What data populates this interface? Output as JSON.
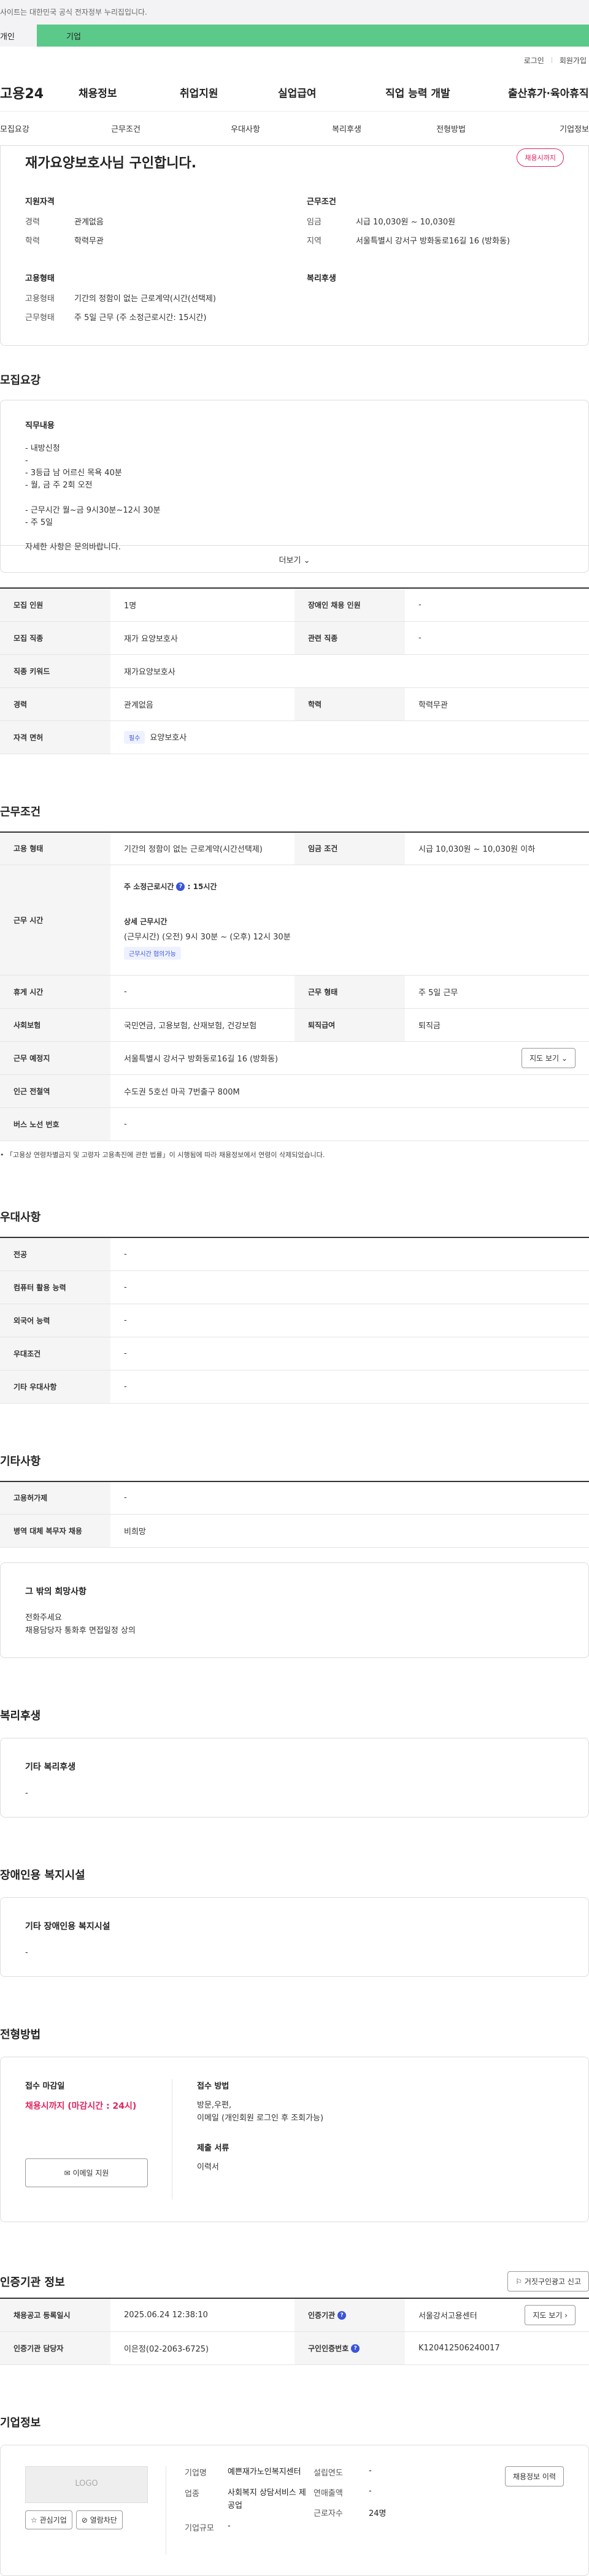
{
  "top_notice": "사이트는 대한민국 공식 전자정부 누리집입니다.",
  "tabs": {
    "person": "개인",
    "corp": "기업"
  },
  "util": {
    "login": "로그인",
    "join": "회원가입"
  },
  "logo": "고용24",
  "gnb": [
    "채용정보",
    "취업지원",
    "실업급여",
    "직업 능력 개발",
    "출산휴가·육아휴직"
  ],
  "subnav": [
    "모집요강",
    "근무조건",
    "우대사항",
    "복리후생",
    "전형방법",
    "기업정보"
  ],
  "summary": {
    "title": "재가요양보호사님 구인합니다.",
    "status": "채용시까지",
    "qual_title": "지원자격",
    "qual": [
      {
        "k": "경력",
        "v": "관계없음"
      },
      {
        "k": "학력",
        "v": "학력무관"
      }
    ],
    "cond_title": "근무조건",
    "cond": [
      {
        "k": "임금",
        "v": "시급 10,030원 ~ 10,030원"
      },
      {
        "k": "지역",
        "v": "서울특별시 강서구 방화동로16길 16 (방화동)"
      }
    ],
    "type_title": "고용형태",
    "type": [
      {
        "k": "고용형태",
        "v": "기간의 정함이 없는 근로계약(시간(선택제)"
      },
      {
        "k": "근무형태",
        "v": "주 5일 근무 (주 소정근로시간: 15시간)"
      }
    ],
    "welfare_title": "복리후생"
  },
  "recruit": {
    "title": "모집요강",
    "job_label": "직무내용",
    "lines": [
      "- 내방신청",
      "-",
      "- 3등급 남 어르신 목욕 40분",
      "- 월, 금 주 2회 오전",
      "",
      "- 근무시간 월~금 9시30분~12시 30분",
      "- 주 5일",
      "",
      "자세한 사항은 문의바랍니다."
    ],
    "more": "더보기",
    "rows": {
      "r1": [
        "모집 인원",
        "1명",
        "장애인 채용 인원",
        "-"
      ],
      "r2": [
        "모집 직종",
        "재가 요양보호사",
        "관련 직종",
        "-"
      ],
      "r3": [
        "직종 키워드",
        "재가요양보호사"
      ],
      "r4": [
        "경력",
        "관계없음",
        "학력",
        "학력무관"
      ],
      "r5": [
        "자격 면허",
        "필수",
        "요양보호사"
      ]
    }
  },
  "work": {
    "title": "근무조건",
    "r1": [
      "고용 형태",
      "기간의 정함이 없는 근로계약(시간선택제)",
      "임금 조건",
      "시급 10,030원 ~ 10,030원 이하"
    ],
    "hours_label": "근무 시간",
    "weekly": "주 소정근로시간",
    "weekly_val": ": 15시간",
    "detail_title": "상세 근무시간",
    "detail": "(근무시간) (오전) 9시 30분 ~ (오후) 12시 30분",
    "detail_chip": "근무시간 협의가능",
    "r3": [
      "휴게 시간",
      "-",
      "근무 형태",
      "주 5일 근무"
    ],
    "r4": [
      "사회보험",
      "국민연금, 고용보험, 산재보험, 건강보험",
      "퇴직급여",
      "퇴직금"
    ],
    "r5": [
      "근무 예정지",
      "서울특별시 강서구 방화동로16길 16 (방화동)"
    ],
    "map_btn": "지도 보기",
    "r6": [
      "인근 전철역",
      "수도권 5호선 마곡 7번출구 800M"
    ],
    "r7": [
      "버스 노선 번호",
      "-"
    ],
    "note": "「고용상 연령차별금지 및 고령자 고용촉진에 관한 법률」이 시행됨에 따라 채용정보에서 연령이 삭제되었습니다."
  },
  "pref": {
    "title": "우대사항",
    "rows": [
      [
        "전공",
        "-"
      ],
      [
        "컴퓨터 활용 능력",
        "-"
      ],
      [
        "외국어 능력",
        "-"
      ],
      [
        "우대조건",
        "-"
      ],
      [
        "기타 우대사항",
        "-"
      ]
    ]
  },
  "etc": {
    "title": "기타사항",
    "rows": [
      [
        "고용허가제",
        "-"
      ],
      [
        "병역 대체 복무자 채용",
        "비희망"
      ]
    ],
    "box_title": "그 밖의 희망사항",
    "box_lines": [
      "전화주세요",
      "채용담당자 통화후 면접일정 상의"
    ]
  },
  "welfare": {
    "title": "복리후생",
    "label": "기타 복리후생",
    "value": "-"
  },
  "disab": {
    "title": "장애인용 복지시설",
    "label": "기타 장애인용 복지시설",
    "value": "-"
  },
  "selection": {
    "title": "전형방법",
    "deadline_label": "접수 마감일",
    "deadline": "채용시까지 (마감시간 : 24시)",
    "email_btn": "이메일 지원",
    "method_label": "접수 방법",
    "method_lines": [
      "방문,우편,",
      "이메일 (개인회원 로그인 후 조회가능)"
    ],
    "docs_label": "제출 서류",
    "docs": "이력서"
  },
  "cert": {
    "title": "인증기관 정보",
    "report_btn": "거짓구인광고 신고",
    "r1": [
      "채용공고 등록일시",
      "2025.06.24 12:38:10",
      "인증기관",
      "서울강서고용센터"
    ],
    "map_btn": "지도 보기",
    "r2": [
      "인증기관 담당자",
      "이은정(02-2063-6725)",
      "구인인증번호",
      "K120412506240017"
    ]
  },
  "company": {
    "title": "기업정보",
    "logo": "LOGO",
    "fav_btn": "관심기업",
    "block_btn": "열람차단",
    "name_label": "기업명",
    "name": "예쁜재가노인복지센터",
    "industry_label": "업종",
    "industry": "사회복지 상담서비스 제공업",
    "size_label": "기업규모",
    "size": "-",
    "founded_label": "설립연도",
    "founded": "-",
    "sales_label": "연매출액",
    "sales": "-",
    "emp_label": "근로자수",
    "emp": "24명",
    "history_btn": "채용정보 이력"
  }
}
